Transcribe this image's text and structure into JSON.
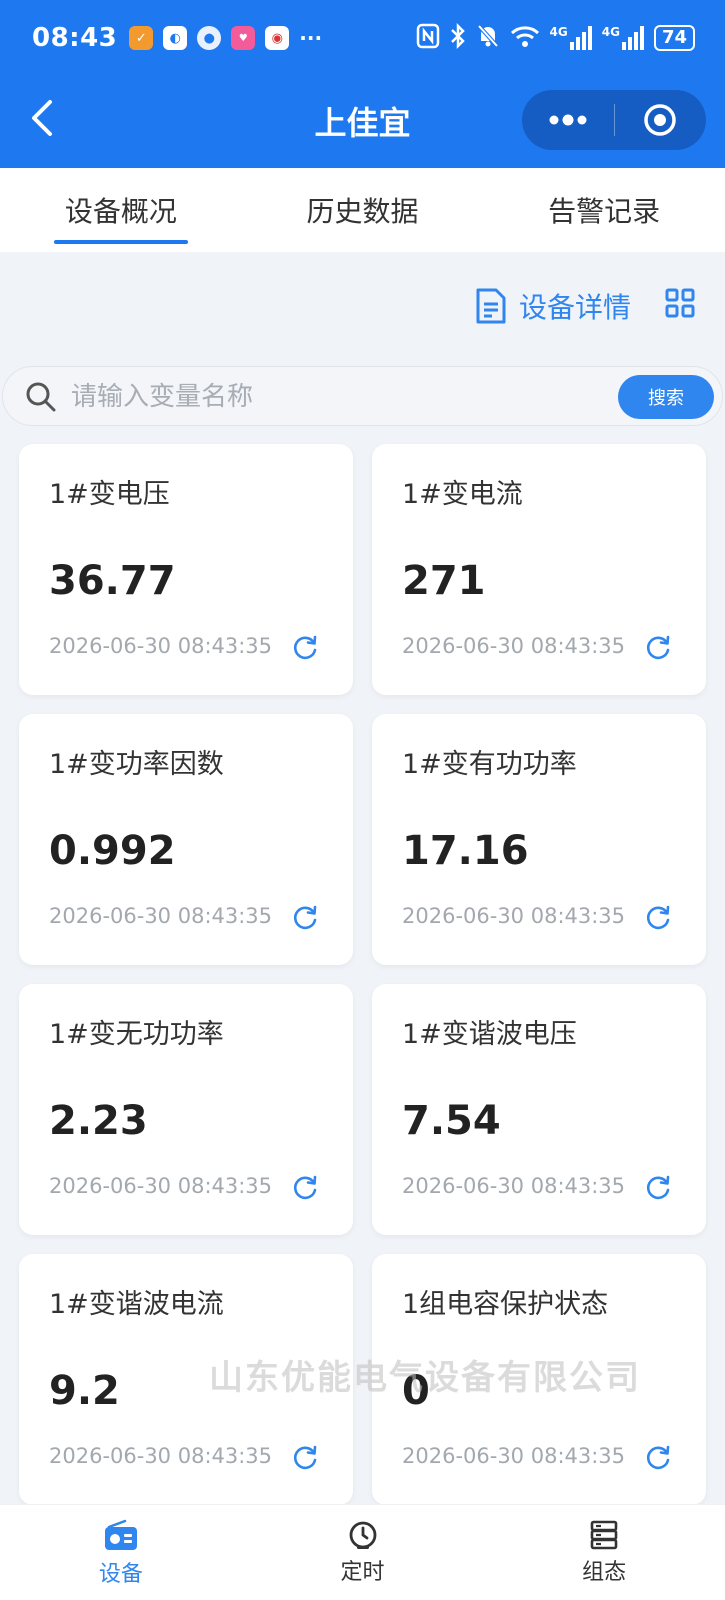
{
  "status": {
    "time": "08:43",
    "network_labels": [
      "4G",
      "4G"
    ],
    "battery": "74",
    "more": "···"
  },
  "nav": {
    "title": "上佳宜",
    "capsule_more_icon": "more-dots-icon",
    "capsule_close_icon": "target-circle-icon"
  },
  "tabs": [
    {
      "label": "设备概况",
      "active": true
    },
    {
      "label": "历史数据",
      "active": false
    },
    {
      "label": "告警记录",
      "active": false
    }
  ],
  "detail": {
    "label": "设备详情"
  },
  "search": {
    "placeholder": "请输入变量名称",
    "value": "",
    "button": "搜索"
  },
  "cards": [
    {
      "title": "1#变电压",
      "value": "36.77",
      "time": "2026-06-30 08:43:35"
    },
    {
      "title": "1#变电流",
      "value": "271",
      "time": "2026-06-30 08:43:35"
    },
    {
      "title": "1#变功率因数",
      "value": "0.992",
      "time": "2026-06-30 08:43:35"
    },
    {
      "title": "1#变有功功率",
      "value": "17.16",
      "time": "2026-06-30 08:43:35"
    },
    {
      "title": "1#变无功功率",
      "value": "2.23",
      "time": "2026-06-30 08:43:35"
    },
    {
      "title": "1#变谐波电压",
      "value": "7.54",
      "time": "2026-06-30 08:43:35"
    },
    {
      "title": "1#变谐波电流",
      "value": "9.2",
      "time": "2026-06-30 08:43:35"
    },
    {
      "title": "1组电容保护状态",
      "value": "0",
      "time": "2026-06-30 08:43:35"
    }
  ],
  "watermark": "山东优能电气设备有限公司",
  "bottom_nav": [
    {
      "label": "设备",
      "icon": "radio-device-icon",
      "active": true
    },
    {
      "label": "定时",
      "icon": "timer-icon",
      "active": false
    },
    {
      "label": "组态",
      "icon": "server-stack-icon",
      "active": false
    }
  ],
  "colors": {
    "primary": "#1e78f0",
    "accent": "#2f86ee",
    "background": "#f0f3f8"
  }
}
